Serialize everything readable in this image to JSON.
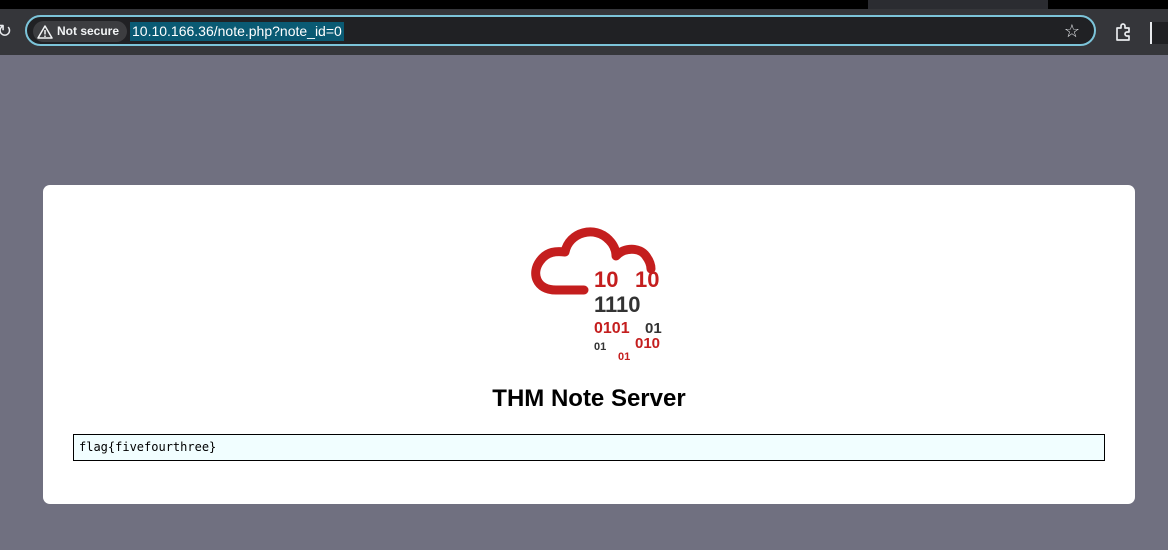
{
  "browser": {
    "security_label": "Not secure",
    "url": "10.10.166.36/note.php?note_id=0",
    "icons": {
      "reload": "reload-icon",
      "warning": "warning-icon",
      "bookmark": "star-icon",
      "extensions": "puzzle-icon"
    }
  },
  "page": {
    "title": "THM Note Server",
    "note_content": "flag{fivefourthree}",
    "logo": {
      "binary_lines": [
        "10",
        "10",
        "1110",
        "0101",
        "01",
        "01",
        "010",
        "01"
      ]
    }
  },
  "colors": {
    "page_background": "#707080",
    "card_background": "#ffffff",
    "note_background": "#f1feff",
    "logo_red": "#c41e1e",
    "logo_dark": "#333333",
    "browser_bar": "#35363a",
    "omnibox_border": "#7cc4d9",
    "url_highlight": "#0a5a73"
  }
}
